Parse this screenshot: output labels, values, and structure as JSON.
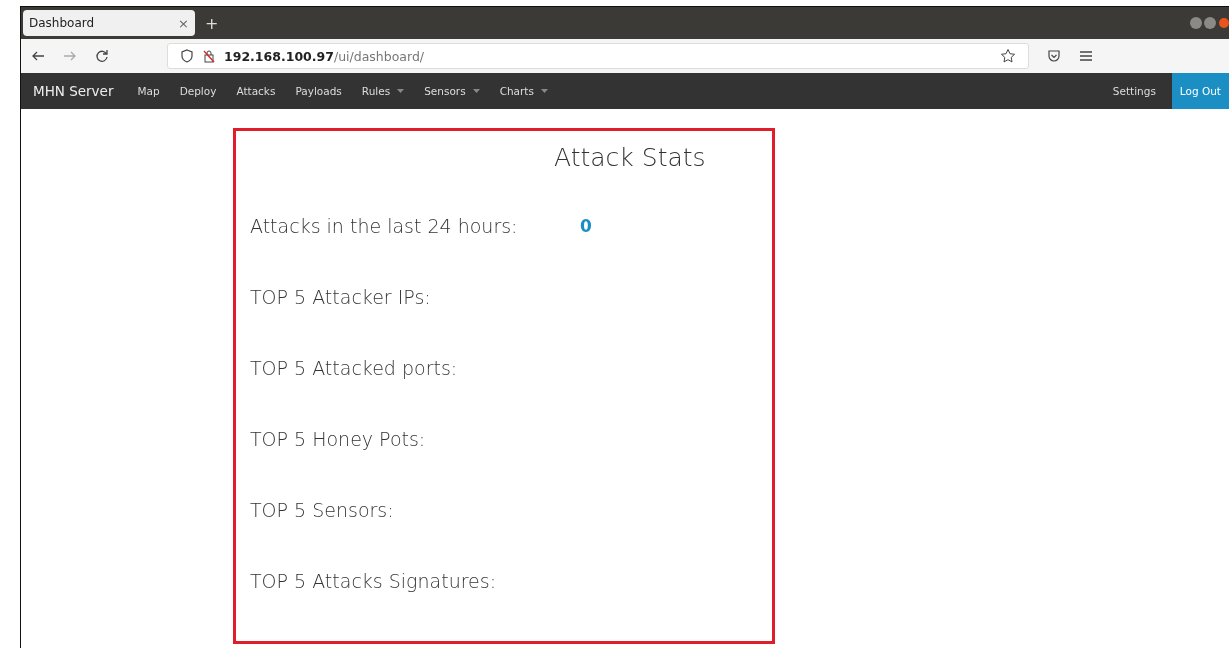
{
  "browser": {
    "tab": {
      "title": "Dashboard",
      "close": "×"
    },
    "new_tab": "+",
    "url": {
      "host": "192.168.100.97",
      "path": "/ui/dashboard/"
    }
  },
  "navbar": {
    "brand": "MHN Server",
    "items": [
      {
        "label": "Map",
        "dropdown": false
      },
      {
        "label": "Deploy",
        "dropdown": false
      },
      {
        "label": "Attacks",
        "dropdown": false
      },
      {
        "label": "Payloads",
        "dropdown": false
      },
      {
        "label": "Rules",
        "dropdown": true
      },
      {
        "label": "Sensors",
        "dropdown": true
      },
      {
        "label": "Charts",
        "dropdown": true
      }
    ],
    "right": [
      {
        "label": "Settings",
        "selected": false
      },
      {
        "label": "Log Out",
        "selected": true
      }
    ]
  },
  "stats": {
    "title": "Attack Stats",
    "rows": [
      {
        "label": "Attacks in the last 24 hours:",
        "value": "0"
      },
      {
        "label": "TOP 5 Attacker IPs:"
      },
      {
        "label": "TOP 5 Attacked ports:"
      },
      {
        "label": "TOP 5 Honey Pots:"
      },
      {
        "label": "TOP 5 Sensors:"
      },
      {
        "label": "TOP 5 Attacks Signatures:"
      }
    ]
  }
}
